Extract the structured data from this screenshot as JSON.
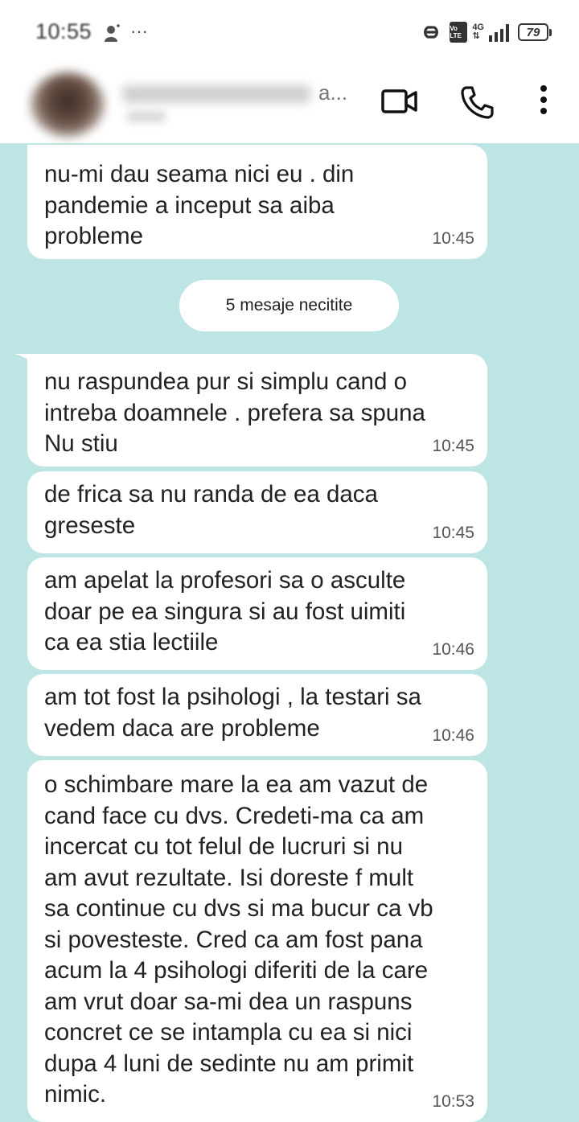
{
  "status_bar": {
    "time": "10:55",
    "dots": "···",
    "volte": "Vo LTE",
    "network": "4G",
    "battery": "79"
  },
  "header": {
    "contact_name_suffix": "a...",
    "video_icon": "video-camera-icon",
    "phone_icon": "phone-icon",
    "more_icon": "more-vertical-icon"
  },
  "chat": {
    "unread_label": "5 mesaje necitite",
    "messages": [
      {
        "text": "nu-mi dau seama nici eu . din\npandemie a inceput sa aiba\nprobleme",
        "time": "10:45"
      },
      {
        "text": "nu raspundea pur si simplu cand o\nintreba doamnele . prefera sa spuna\nNu stiu",
        "time": "10:45"
      },
      {
        "text": "de frica sa nu randa de ea daca\ngreseste",
        "time": "10:45"
      },
      {
        "text": "am apelat la profesori sa o asculte\ndoar pe ea singura si au fost uimiti\nca ea stia lectiile",
        "time": "10:46"
      },
      {
        "text": "am tot fost la psihologi , la testari sa\nvedem daca are probleme",
        "time": "10:46"
      },
      {
        "text": "o schimbare mare la ea am vazut de\ncand face cu dvs. Credeti-ma ca am\nincercat cu tot felul de lucruri  si nu\nam avut rezultate. Isi doreste f mult\nsa continue cu dvs si ma bucur ca vb\nsi povesteste. Cred ca am fost pana\nacum la 4 psihologi diferiti de la care\nam vrut doar sa-mi dea un raspuns\nconcret ce se intampla cu ea si nici\ndupa 4 luni de sedinte nu am primit\nnimic.",
        "time": "10:53"
      }
    ]
  },
  "colors": {
    "chat_background": "#bde5e4",
    "bubble": "#ffffff"
  }
}
